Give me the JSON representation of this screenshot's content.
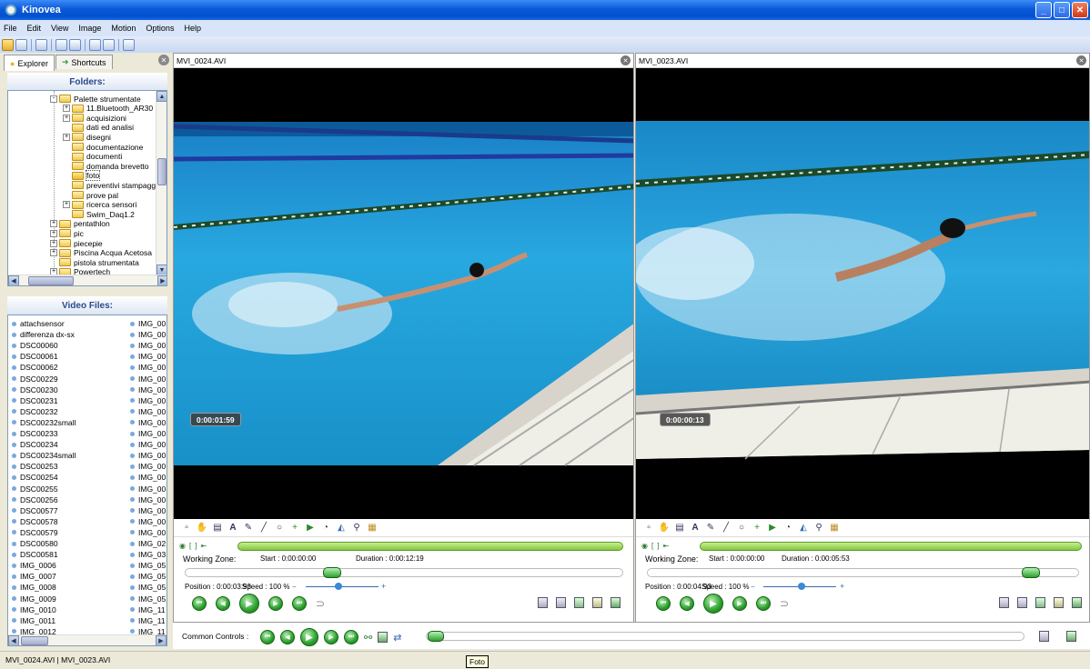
{
  "window": {
    "title": "Kinovea"
  },
  "menu": [
    "File",
    "Edit",
    "View",
    "Image",
    "Motion",
    "Options",
    "Help"
  ],
  "explorer": {
    "tabs": [
      "Explorer",
      "Shortcuts"
    ],
    "folders_header": "Folders:",
    "video_files_header": "Video Files:",
    "folders": [
      {
        "label": "Palette strumentate",
        "indent": 2,
        "expander": "-"
      },
      {
        "label": "11.Bluetooth_AR30",
        "indent": 3,
        "expander": "+"
      },
      {
        "label": "acquisizioni",
        "indent": 3,
        "expander": "+"
      },
      {
        "label": "dati ed analisi",
        "indent": 3,
        "expander": ""
      },
      {
        "label": "disegni",
        "indent": 3,
        "expander": "+"
      },
      {
        "label": "documentazione",
        "indent": 3,
        "expander": ""
      },
      {
        "label": "documenti",
        "indent": 3,
        "expander": ""
      },
      {
        "label": "domanda brevetto",
        "indent": 3,
        "expander": ""
      },
      {
        "label": "foto",
        "indent": 3,
        "expander": "",
        "selected": true
      },
      {
        "label": "preventivi stampagg",
        "indent": 3,
        "expander": ""
      },
      {
        "label": "prove pal",
        "indent": 3,
        "expander": ""
      },
      {
        "label": "ricerca sensori",
        "indent": 3,
        "expander": "+"
      },
      {
        "label": "Swim_Daq1.2",
        "indent": 3,
        "expander": ""
      },
      {
        "label": "pentathlon",
        "indent": 2,
        "expander": "+"
      },
      {
        "label": "pic",
        "indent": 2,
        "expander": "+"
      },
      {
        "label": "piecepie",
        "indent": 2,
        "expander": "+"
      },
      {
        "label": "Piscina Acqua Acetosa",
        "indent": 2,
        "expander": "+"
      },
      {
        "label": "pistola strumentata",
        "indent": 2,
        "expander": ""
      },
      {
        "label": "Powertech",
        "indent": 2,
        "expander": "+"
      }
    ],
    "files_col1": [
      "attachsensor",
      "differenza dx-sx",
      "DSC00060",
      "DSC00061",
      "DSC00062",
      "DSC00229",
      "DSC00230",
      "DSC00231",
      "DSC00232",
      "DSC00232small",
      "DSC00233",
      "DSC00234",
      "DSC00234small",
      "DSC00253",
      "DSC00254",
      "DSC00255",
      "DSC00256",
      "DSC00577",
      "DSC00578",
      "DSC00579",
      "DSC00580",
      "DSC00581",
      "IMG_0006",
      "IMG_0007",
      "IMG_0008",
      "IMG_0009",
      "IMG_0010",
      "IMG_0011",
      "IMG_0012"
    ],
    "files_col2": [
      "IMG_00",
      "IMG_00",
      "IMG_00",
      "IMG_00",
      "IMG_00",
      "IMG_00",
      "IMG_00",
      "IMG_00",
      "IMG_00",
      "IMG_00",
      "IMG_00",
      "IMG_00",
      "IMG_00",
      "IMG_00",
      "IMG_00",
      "IMG_00",
      "IMG_00",
      "IMG_00",
      "IMG_00",
      "IMG_00",
      "IMG_02",
      "IMG_03",
      "IMG_05",
      "IMG_05",
      "IMG_05",
      "IMG_05",
      "IMG_11",
      "IMG_11",
      "IMG_11"
    ]
  },
  "players": [
    {
      "file": "MVI_0024.AVI",
      "timecode": "0:00:01:59",
      "working_zone_label": "Working Zone:",
      "start": "Start : 0:00:00:00",
      "duration": "Duration : 0:00:12:19",
      "position": "Position : 0:00:03:93",
      "speed": "Speed : 100 %",
      "progress": 0.33
    },
    {
      "file": "MVI_0023.AVI",
      "timecode": "0:00:00:13",
      "working_zone_label": "Working Zone:",
      "start": "Start : 0:00:00:00",
      "duration": "Duration : 0:00:05:53",
      "position": "Position : 0:00:04:93",
      "speed": "Speed : 100 %",
      "progress": 0.91
    }
  ],
  "common_controls": {
    "label": "Common Controls :"
  },
  "status": {
    "text": "MVI_0024.AVI | MVI_0023.AVI",
    "tooltip": "Foto"
  },
  "colors": {
    "accent": "#0a5ad8",
    "water": "#1aa0d8",
    "timeline": "#9ce05a"
  }
}
